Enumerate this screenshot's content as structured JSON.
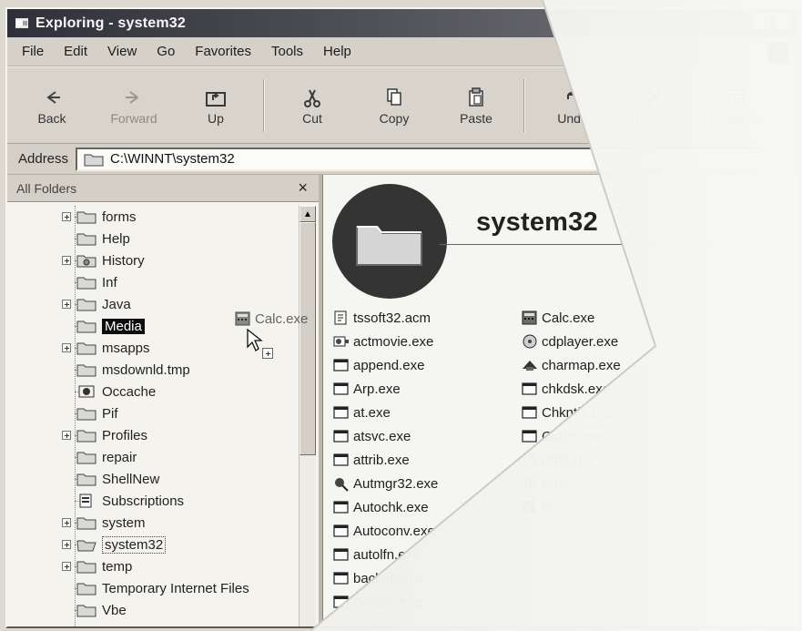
{
  "window": {
    "title": "Exploring - system32"
  },
  "menus": [
    "File",
    "Edit",
    "View",
    "Go",
    "Favorites",
    "Tools",
    "Help"
  ],
  "toolbar": {
    "back": "Back",
    "forward": "Forward",
    "up": "Up",
    "cut": "Cut",
    "copy": "Copy",
    "paste": "Paste",
    "undo": "Undo",
    "delete": "Delete",
    "properties": "Propertie"
  },
  "address": {
    "label": "Address",
    "value": "C:\\WINNT\\system32"
  },
  "left_pane": {
    "title": "All Folders",
    "close_label": "×",
    "drag_label": "Calc.exe",
    "tree": [
      {
        "label": "forms",
        "expandable": true,
        "selected": false
      },
      {
        "label": "Help",
        "expandable": false,
        "selected": false
      },
      {
        "label": "History",
        "expandable": true,
        "selected": false
      },
      {
        "label": "Inf",
        "expandable": false,
        "selected": false
      },
      {
        "label": "Java",
        "expandable": true,
        "selected": false
      },
      {
        "label": "Media",
        "expandable": false,
        "selected": true
      },
      {
        "label": "msapps",
        "expandable": true,
        "selected": false
      },
      {
        "label": "msdownld.tmp",
        "expandable": false,
        "selected": false
      },
      {
        "label": "Occache",
        "expandable": false,
        "selected": false
      },
      {
        "label": "Pif",
        "expandable": false,
        "selected": false
      },
      {
        "label": "Profiles",
        "expandable": true,
        "selected": false
      },
      {
        "label": "repair",
        "expandable": false,
        "selected": false
      },
      {
        "label": "ShellNew",
        "expandable": false,
        "selected": false
      },
      {
        "label": "Subscriptions",
        "expandable": false,
        "selected": false
      },
      {
        "label": "system",
        "expandable": true,
        "selected": false
      },
      {
        "label": "system32",
        "expandable": true,
        "selected": false
      },
      {
        "label": "temp",
        "expandable": true,
        "selected": false
      },
      {
        "label": "Temporary Internet Files",
        "expandable": false,
        "selected": false
      },
      {
        "label": "Vbe",
        "expandable": false,
        "selected": false
      }
    ]
  },
  "right_pane": {
    "folder_name": "system32",
    "files_col1": [
      "tssoft32.acm",
      "actmovie.exe",
      "append.exe",
      "Arp.exe",
      "at.exe",
      "atsvc.exe",
      "attrib.exe",
      "Autmgr32.exe",
      "Autochk.exe",
      "Autoconv.exe",
      "autolfn.exe",
      "backup.exe",
      "Bootok.exe"
    ],
    "files_col2": [
      "Calc.exe",
      "cdplayer.exe",
      "charmap.exe",
      "chkdsk.exe",
      "Chkntfs.exe",
      "Ckcnv.exe",
      "clipbrd.e",
      "clips",
      "C"
    ]
  }
}
